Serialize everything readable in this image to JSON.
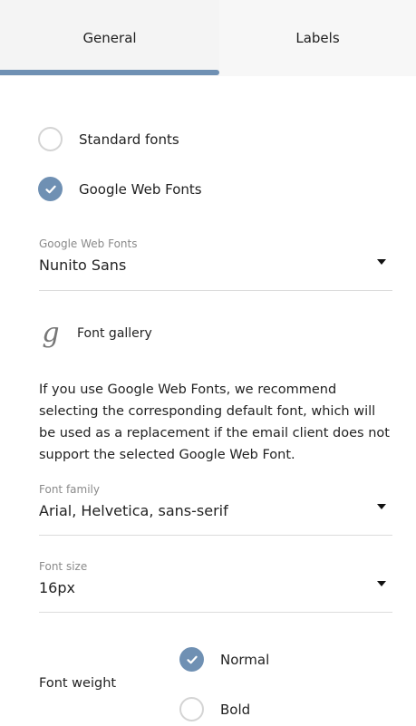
{
  "tabs": {
    "general": "General",
    "labels": "Labels"
  },
  "font_source": {
    "standard": "Standard fonts",
    "google": "Google Web Fonts",
    "selected": "google"
  },
  "google_font_select": {
    "label": "Google Web Fonts",
    "value": "Nunito Sans"
  },
  "font_gallery": {
    "icon": "google-g-icon",
    "label": "Font gallery"
  },
  "info_text": "If you use Google Web Fonts, we recommend selecting the corresponding default font, which will be used as a replacement if the email client does not support the selected Google Web Font.",
  "font_family_select": {
    "label": "Font family",
    "value": "Arial, Helvetica, sans-serif"
  },
  "font_size_select": {
    "label": "Font size",
    "value": "16px"
  },
  "font_weight": {
    "label": "Font weight",
    "normal": "Normal",
    "bold": "Bold",
    "selected": "normal"
  },
  "colors": {
    "accent": "#6f90b3",
    "tab_bg": "#f4f4f4",
    "divider": "#dcdcdc"
  }
}
